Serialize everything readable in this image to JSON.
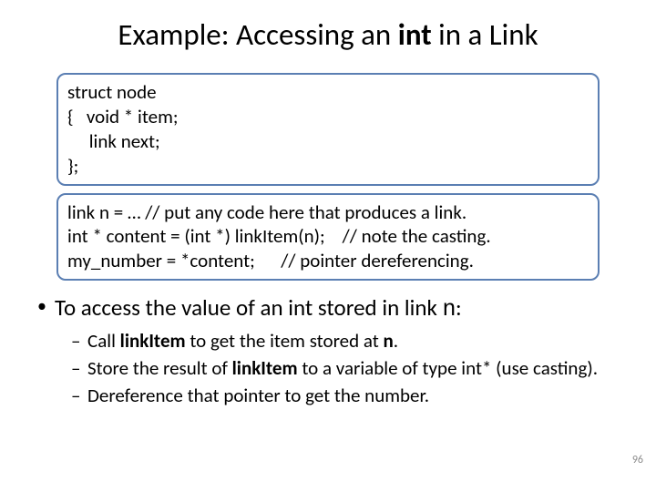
{
  "title": {
    "pre": "Example: Accessing an ",
    "bold": "int",
    "post": " in a Link"
  },
  "code1": {
    "l1": "struct node",
    "l2": "{   void * item;",
    "l3": "     link next;",
    "l4": "};"
  },
  "code2": {
    "l1": "link n = … // put any code here that produces a link.",
    "l2": "int * content = (int *) linkItem(n);    // note the casting.",
    "l3": "my_number = *content;      // pointer dereferencing."
  },
  "main_bullet": {
    "pre": "To access the value of an int stored in link ",
    "mono": "n",
    "post": ":"
  },
  "sub": {
    "a": {
      "t1": "Call ",
      "b1": "linkItem",
      "t2": " to get the item stored at ",
      "b2": "n",
      "t3": "."
    },
    "b": {
      "t1": "Store the result of ",
      "b1": "linkItem",
      "t2": " to a variable of type int* (use casting)."
    },
    "c": {
      "t1": "Dereference that pointer to get the number."
    }
  },
  "page_number": "96"
}
